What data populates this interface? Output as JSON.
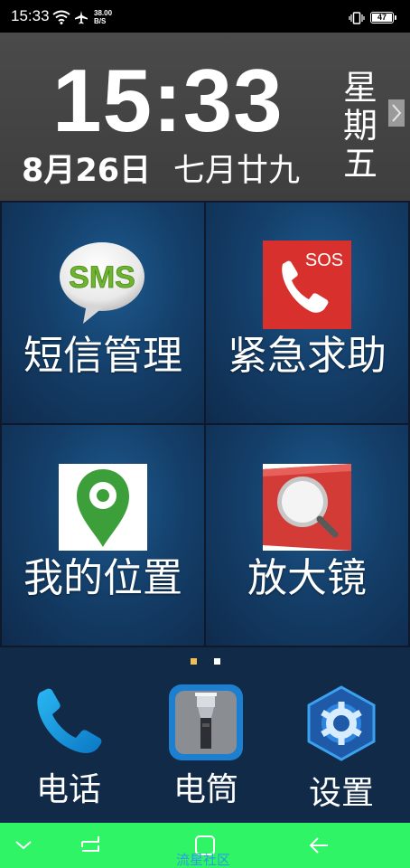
{
  "status_bar": {
    "time": "15:33",
    "net_speed_value": "38.00",
    "net_speed_unit": "B/S",
    "battery": "47",
    "icons": [
      "wifi-icon",
      "airplane-icon",
      "vibrate-icon",
      "battery-icon"
    ]
  },
  "clock": {
    "time": "15:33",
    "date": "8月26日",
    "lunar_date": "七月廿九",
    "weekday": "星期五"
  },
  "tiles": [
    {
      "label": "短信管理",
      "icon": "sms-icon",
      "icon_text": "SMS"
    },
    {
      "label": "紧急求助",
      "icon": "sos-phone-icon",
      "icon_text": "SOS"
    },
    {
      "label": "我的位置",
      "icon": "location-pin-icon"
    },
    {
      "label": "放大镜",
      "icon": "magnifier-icon"
    }
  ],
  "pager": {
    "current_page": 1,
    "total_pages": 2
  },
  "dock": [
    {
      "label": "电话",
      "icon": "phone-icon"
    },
    {
      "label": "电筒",
      "icon": "flashlight-icon"
    },
    {
      "label": "设置",
      "icon": "settings-gear-icon"
    }
  ],
  "nav_bar": {
    "buttons": [
      "chevron-down-icon",
      "recent-apps-icon",
      "home-icon",
      "back-icon"
    ],
    "watermark": "流星社区"
  },
  "colors": {
    "clock_panel": "#444444",
    "tile_blue": "#143f6a",
    "dock_bg": "#102a48",
    "nav_bar": "#2ef466",
    "sos_red": "#d8312d",
    "pin_green": "#3d9f3a",
    "dot_active": "#f0c057"
  }
}
